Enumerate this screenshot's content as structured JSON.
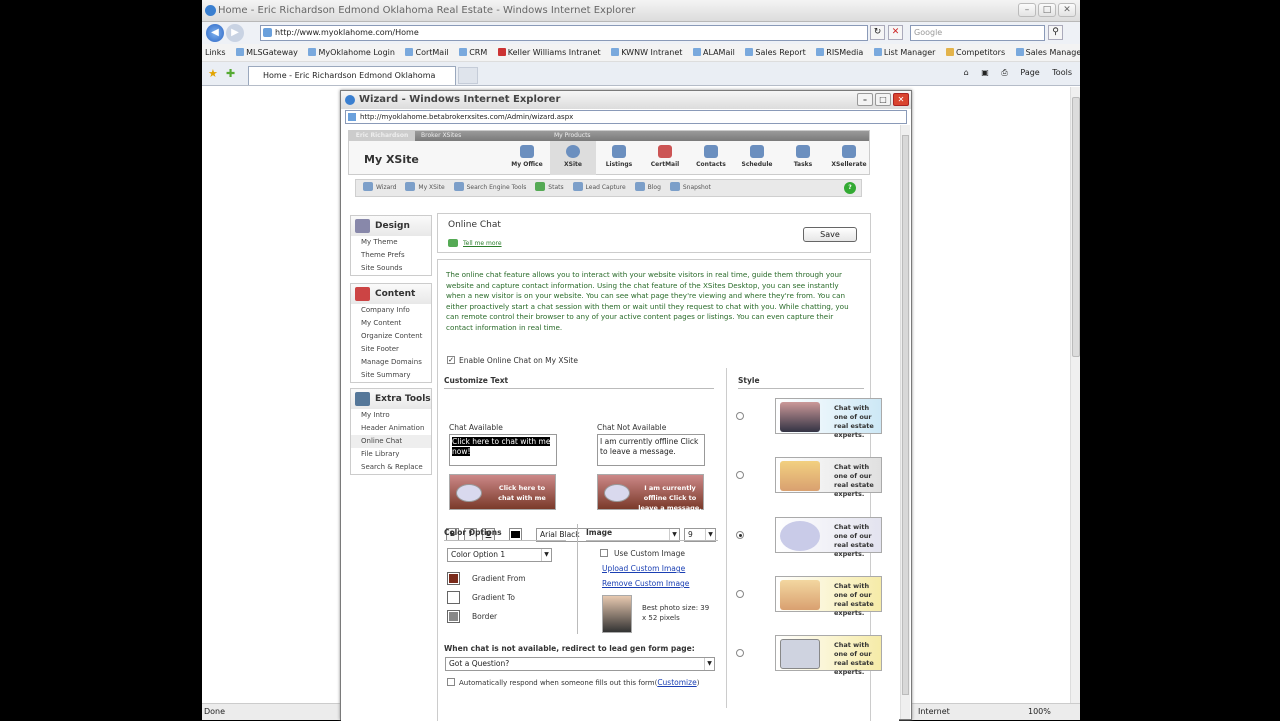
{
  "browser": {
    "title": "Home - Eric Richardson Edmond Oklahoma Real Estate - Windows Internet Explorer",
    "address": "http://www.myoklahome.com/Home",
    "search_placeholder": "Google",
    "links_label": "Links",
    "links": [
      "MLSGateway",
      "MyOklahome Login",
      "CortMail",
      "CRM",
      "Keller Williams Intranet",
      "KWNW Intranet",
      "ALAMail",
      "Sales Report",
      "RISMedia",
      "List Manager",
      "Competitors",
      "Sales Manager Dashboard"
    ],
    "tab_label": "Home - Eric Richardson Edmond Oklahoma Real Estate",
    "tools": {
      "page": "Page",
      "tools": "Tools"
    },
    "status": {
      "done": "Done",
      "zone": "Internet",
      "zoom": "100%"
    }
  },
  "popup": {
    "title": "Wizard - Windows Internet Explorer",
    "address": "http://myoklahome.betabrokerxsites.com/Admin/wizard.aspx",
    "top_tabs": {
      "user": "Eric Richardson",
      "broker": "Broker XSites",
      "products": "My Products"
    },
    "section": "My XSite",
    "nav": [
      "My Office",
      "XSite",
      "Listings",
      "CertMail",
      "Contacts",
      "Schedule",
      "Tasks",
      "XSellerate"
    ],
    "subnav": [
      "Wizard",
      "My XSite",
      "Search Engine Tools",
      "Stats",
      "Lead Capture",
      "Blog",
      "Snapshot"
    ],
    "left": {
      "design": {
        "title": "Design",
        "items": [
          "My Theme",
          "Theme Prefs",
          "Site Sounds"
        ]
      },
      "content": {
        "title": "Content",
        "items": [
          "Company Info",
          "My Content",
          "Organize Content",
          "Site Footer",
          "Manage Domains",
          "Site Summary"
        ]
      },
      "extra": {
        "title": "Extra Tools",
        "items": [
          "My Intro",
          "Header Animation",
          "Online Chat",
          "File Library",
          "Search & Replace"
        ]
      }
    },
    "page_title": "Online Chat",
    "tell_me": "Tell me more",
    "save": "Save",
    "description": "The online chat feature allows you to interact with your website visitors in real time, guide them through your website and capture contact information.  Using the chat feature of the XSites Desktop, you can see instantly when a new visitor is on your website.  You can see what page they're viewing and where they're from.  You can either proactively start a chat session with them or wait until they request to chat with you.  While chatting, you can remote control their browser to any of your active content pages or listings.  You can even capture their contact information in real time.",
    "enable_label": "Enable Online Chat on My XSite",
    "customize_title": "Customize Text",
    "font": "Arial Black",
    "font_size": "9",
    "chat_available_label": "Chat Available",
    "chat_available_text": "Click here to chat with me now!",
    "chat_not_available_label": "Chat Not Available",
    "chat_not_available_text": "I am currently offline  Click to leave a message.",
    "preview_available": "Click here to chat with me",
    "preview_not_available": "I am currently offline  Click to leave a message.",
    "color_title": "Color Options",
    "color_option": "Color Option 1",
    "gradient_from": "Gradient From",
    "gradient_to": "Gradient To",
    "border": "Border",
    "image_title": "Image",
    "use_custom": "Use Custom Image",
    "upload": "Upload Custom Image",
    "remove": "Remove Custom Image",
    "photo_size": "Best photo size: 39 x 52 pixels",
    "style_title": "Style",
    "style_text": "Chat with one of our real estate experts.",
    "redirect_label": "When chat is not available, redirect to lead gen form page:",
    "redirect_value": "Got a Question?",
    "auto_respond": "Automatically respond when someone fills out this form",
    "customize_link": "Customize",
    "colors": {
      "gradient_from": "#7a2a1a",
      "gradient_to": "#ffffff",
      "border": "#888888"
    }
  }
}
